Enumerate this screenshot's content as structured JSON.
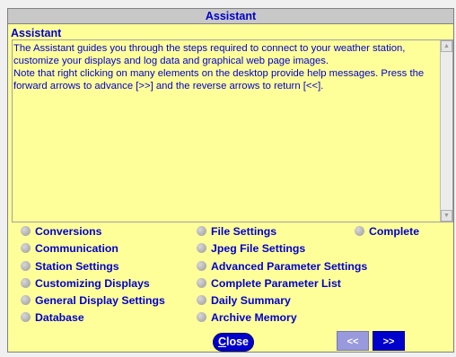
{
  "window": {
    "title": "Assistant"
  },
  "section_label": "Assistant",
  "description": "The Assistant guides you through the steps required to connect to your weather station, customize your displays and log data and graphical web page images.\nNote that right clicking on many elements on the desktop provide help messages. Press the forward arrows to advance [>>] and the reverse arrows to return [<<].",
  "menu": {
    "col1": [
      "Conversions",
      "Communication",
      "Station Settings",
      "Customizing Displays",
      "General Display Settings",
      "Database"
    ],
    "col2": [
      "File Settings",
      "Jpeg File Settings",
      "Advanced Parameter Settings",
      "Complete Parameter List",
      "Daily Summary",
      "Archive Memory"
    ],
    "col3": [
      "Complete"
    ]
  },
  "buttons": {
    "close_first": "C",
    "close_rest": "lose",
    "back": "<<",
    "forward": ">>"
  },
  "colors": {
    "background": "#ffff99",
    "text": "#0000cc",
    "titlebar": "#c8c8c8",
    "button": "#0000cc",
    "button_disabled": "#9999dd"
  }
}
